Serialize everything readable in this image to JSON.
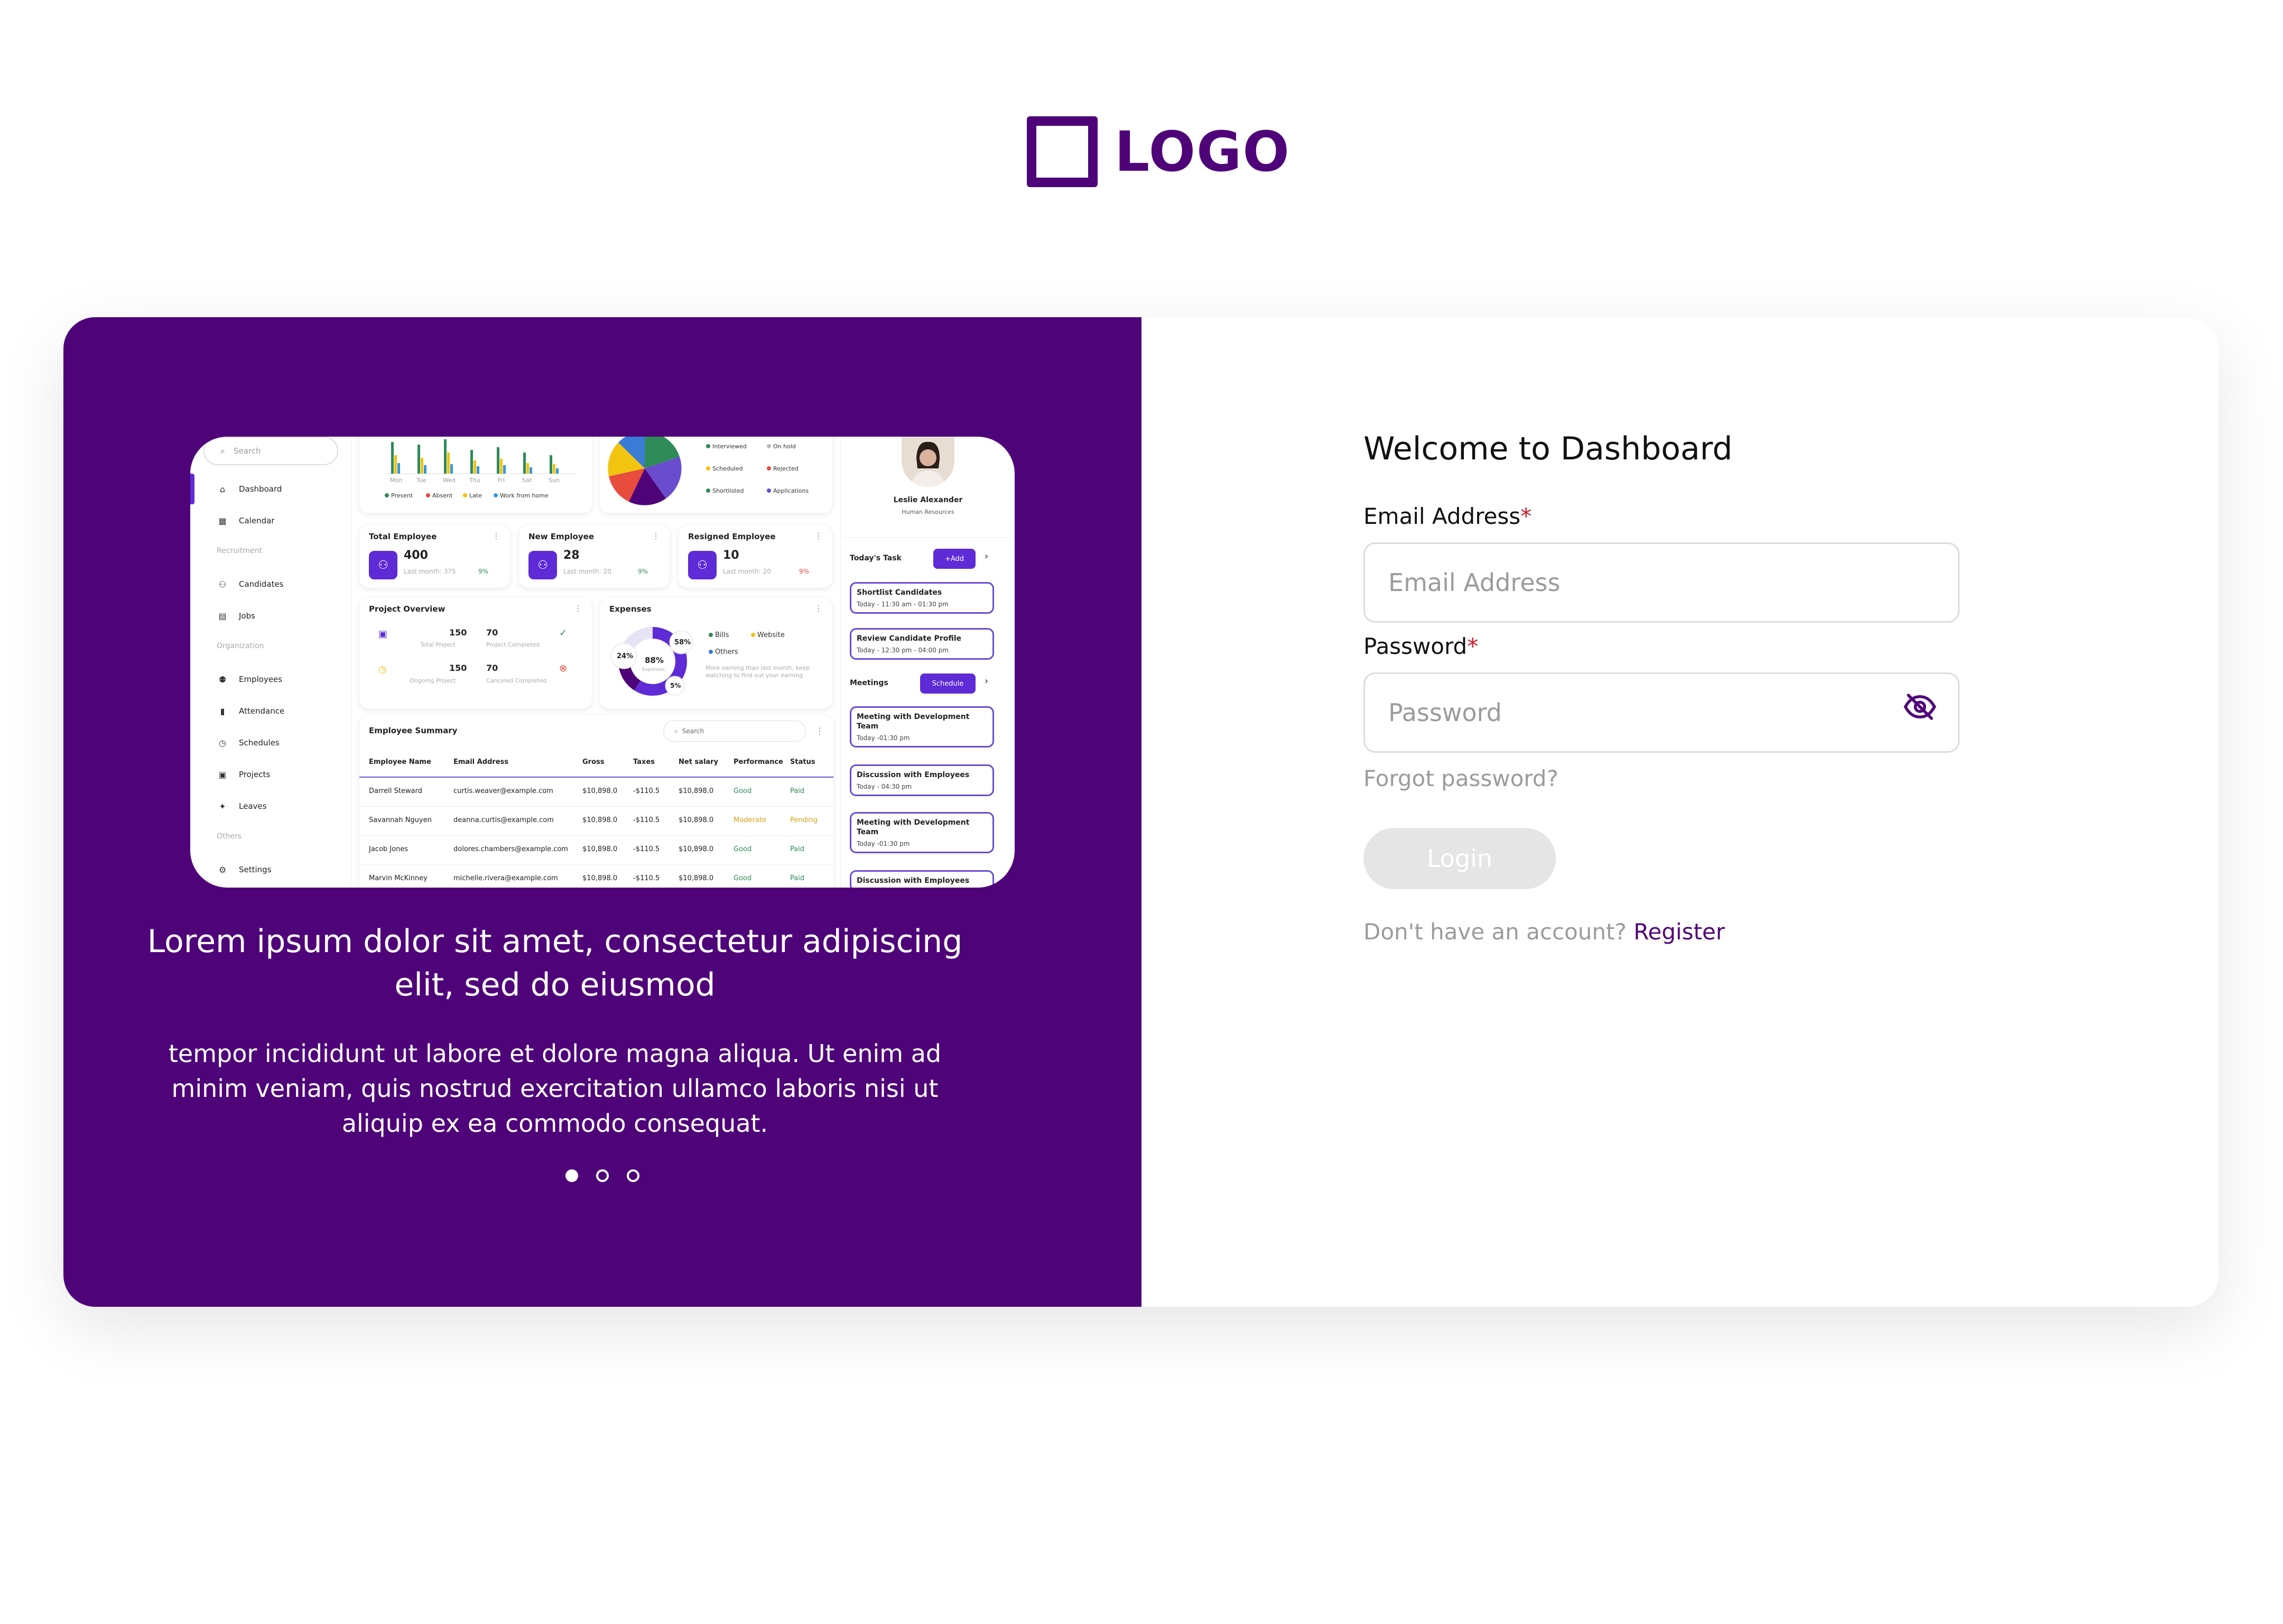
{
  "logo": {
    "text": "LOGO"
  },
  "colors": {
    "brand": "#4f0379",
    "accent": "#5e2bd6",
    "required": "#d11a2a",
    "muted": "#9b9b9b"
  },
  "promo": {
    "title": "Lorem ipsum dolor sit amet, consectetur adipiscing elit, sed do eiusmod",
    "body": "tempor incididunt ut labore et dolore magna aliqua. Ut enim ad minim veniam, quis nostrud exercitation ullamco laboris nisi ut aliquip ex ea commodo consequat.",
    "carousel": {
      "total": 3,
      "active": 1
    }
  },
  "preview": {
    "search_placeholder": "Search",
    "nav": [
      {
        "label": "Dashboard",
        "icon": "home-icon"
      },
      {
        "label": "Calendar",
        "icon": "calendar-icon"
      },
      {
        "label": "Candidates",
        "icon": "users-icon"
      },
      {
        "label": "Jobs",
        "icon": "clipboard-icon"
      },
      {
        "label": "Employees",
        "icon": "people-icon"
      },
      {
        "label": "Attendance",
        "icon": "bar-chart-icon"
      },
      {
        "label": "Schedules",
        "icon": "clock-icon"
      },
      {
        "label": "Projects",
        "icon": "briefcase-icon"
      },
      {
        "label": "Leaves",
        "icon": "sparkle-icon"
      },
      {
        "label": "Settings",
        "icon": "gear-icon"
      }
    ],
    "sections": [
      "Recruitment",
      "Organization",
      "Others"
    ],
    "attendance_chart": {
      "days": [
        "Mon",
        "Tue",
        "Wed",
        "Thu",
        "Fri",
        "Sat",
        "Sun"
      ],
      "legend": [
        "Present",
        "Absent",
        "Late",
        "Work from home"
      ],
      "legend_colors": [
        "#2e8b57",
        "#e74c3c",
        "#f1c40f",
        "#3498db"
      ]
    },
    "candidates_legend": [
      "Interviewed",
      "On hold",
      "Scheduled",
      "Rejected",
      "Shortlisted",
      "Applications"
    ],
    "stats": [
      {
        "title": "Total Employee",
        "value": "400",
        "sub": "Last month: 375",
        "pct": "9%",
        "trend": "up"
      },
      {
        "title": "New Employee",
        "value": "28",
        "sub": "Last month: 20",
        "pct": "9%",
        "trend": "up"
      },
      {
        "title": "Resigned Employee",
        "value": "10",
        "sub": "Last month: 20",
        "pct": "9%",
        "trend": "down"
      }
    ],
    "project_overview": {
      "title": "Project Overview",
      "items": [
        {
          "value": "150",
          "label": "Total Project"
        },
        {
          "value": "70",
          "label": "Project Completed"
        },
        {
          "value": "150",
          "label": "Ongoing Project"
        },
        {
          "value": "70",
          "label": "Canceled Completed"
        }
      ]
    },
    "expenses": {
      "title": "Expenses",
      "center_value": "88%",
      "center_label": "Expenses",
      "labels": [
        "24%",
        "58%",
        "5%"
      ],
      "legend": [
        "Bills",
        "Website",
        "Others"
      ],
      "note": "More earning than last month, keep watching to find out your earning"
    },
    "employee_summary": {
      "title": "Employee Summary",
      "search": "Search",
      "columns": [
        "Employee Name",
        "Email Address",
        "Gross",
        "Taxes",
        "Net salary",
        "Performance",
        "Status"
      ],
      "rows": [
        [
          "Darrell Steward",
          "curtis.weaver@example.com",
          "$10,898.0",
          "-$110.5",
          "$10,898.0",
          "Good",
          "Paid"
        ],
        [
          "Savannah Nguyen",
          "deanna.curtis@example.com",
          "$10,898.0",
          "-$110.5",
          "$10,898.0",
          "Moderate",
          "Pending"
        ],
        [
          "Jacob Jones",
          "dolores.chambers@example.com",
          "$10,898.0",
          "-$110.5",
          "$10,898.0",
          "Good",
          "Paid"
        ],
        [
          "Marvin McKinney",
          "michelle.rivera@example.com",
          "$10,898.0",
          "-$110.5",
          "$10,898.0",
          "Good",
          "Paid"
        ]
      ]
    },
    "profile": {
      "name": "Leslie Alexander",
      "role": "Human Resources"
    },
    "tasks": {
      "title": "Today's Task",
      "add_label": "+Add",
      "items": [
        {
          "title": "Shortlist Candidates",
          "time": "Today - 11:30 am - 01:30 pm"
        },
        {
          "title": "Review Candidate Profile",
          "time": "Today - 12:30 pm - 04:00 pm"
        }
      ]
    },
    "meetings": {
      "title": "Meetings",
      "schedule_label": "Schedule",
      "items": [
        {
          "title": "Meeting with Development Team",
          "time": "Today -01:30 pm"
        },
        {
          "title": "Discussion with Employees",
          "time": "Today - 04:30 pm"
        },
        {
          "title": "Meeting with Development Team",
          "time": "Today -01:30 pm"
        },
        {
          "title": "Discussion with Employees",
          "time": ""
        }
      ]
    }
  },
  "form": {
    "welcome": "Welcome to Dashboard",
    "email_label": "Email Address",
    "email_placeholder": "Email Address",
    "email_value": "",
    "password_label": "Password",
    "password_placeholder": "Password",
    "password_value": "",
    "required_mark": "*",
    "forgot": "Forgot password?",
    "login": "Login",
    "signup_prompt": "Don't have an account?",
    "signup_link": "Register"
  }
}
